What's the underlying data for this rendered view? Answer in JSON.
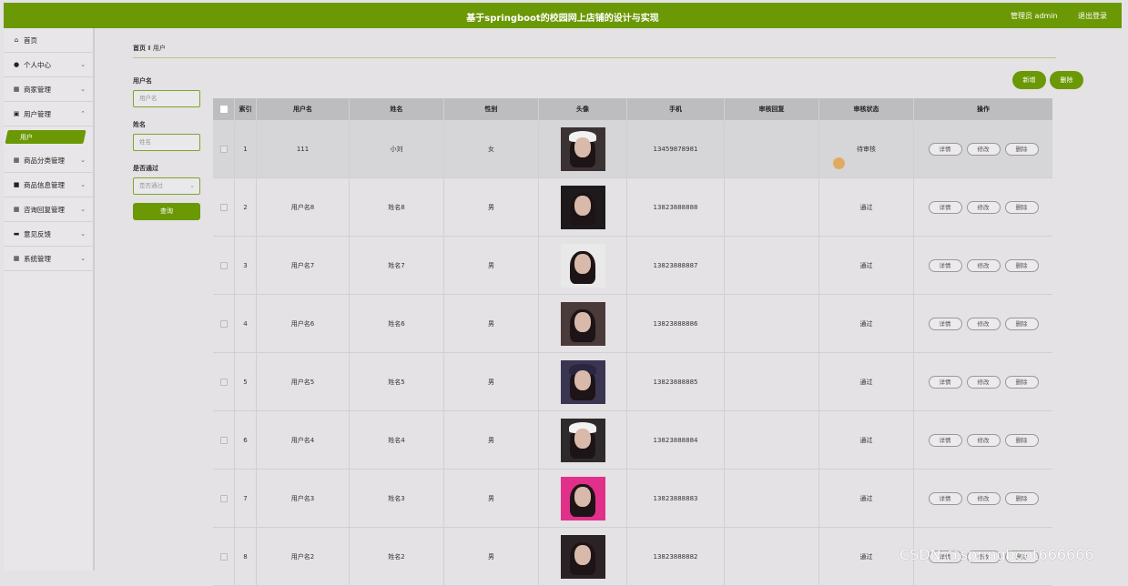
{
  "header": {
    "title": "基于springboot的校园网上店铺的设计与实现",
    "admin_label": "管理员 admin",
    "logout_label": "退出登录"
  },
  "sidebar": {
    "items": [
      {
        "label": "首页",
        "icon": "home-icon"
      },
      {
        "label": "个人中心",
        "icon": "user-icon"
      },
      {
        "label": "商家管理",
        "icon": "grid-icon"
      },
      {
        "label": "用户管理",
        "icon": "users-icon"
      },
      {
        "label": "商品分类管理",
        "icon": "grid-icon"
      },
      {
        "label": "商品信息管理",
        "icon": "box-icon"
      },
      {
        "label": "咨询回复管理",
        "icon": "grid-icon"
      },
      {
        "label": "意见反馈",
        "icon": "feedback-icon"
      },
      {
        "label": "系统管理",
        "icon": "grid-icon"
      }
    ],
    "active_sub": "用户"
  },
  "breadcrumb": {
    "home": "首页",
    "sep": "Ⅱ",
    "current": "用户"
  },
  "search": {
    "username_label": "用户名",
    "username_placeholder": "用户名",
    "name_label": "姓名",
    "name_placeholder": "姓名",
    "approved_label": "是否通过",
    "approved_placeholder": "是否通过",
    "query_button": "查询"
  },
  "actions": {
    "add": "新增",
    "delete": "删除"
  },
  "table": {
    "headers": [
      "索引",
      "用户名",
      "姓名",
      "性别",
      "头像",
      "手机",
      "审核回复",
      "审核状态",
      "操作"
    ],
    "rows": [
      {
        "idx": "1",
        "username": "111",
        "name": "小刘",
        "gender": "女",
        "phone": "13459878981",
        "reply": "",
        "status": "待审核"
      },
      {
        "idx": "2",
        "username": "用户名8",
        "name": "姓名8",
        "gender": "男",
        "phone": "13823888888",
        "reply": "",
        "status": "通过"
      },
      {
        "idx": "3",
        "username": "用户名7",
        "name": "姓名7",
        "gender": "男",
        "phone": "13823888887",
        "reply": "",
        "status": "通过"
      },
      {
        "idx": "4",
        "username": "用户名6",
        "name": "姓名6",
        "gender": "男",
        "phone": "13823888886",
        "reply": "",
        "status": "通过"
      },
      {
        "idx": "5",
        "username": "用户名5",
        "name": "姓名5",
        "gender": "男",
        "phone": "13823888885",
        "reply": "",
        "status": "通过"
      },
      {
        "idx": "6",
        "username": "用户名4",
        "name": "姓名4",
        "gender": "男",
        "phone": "13823888884",
        "reply": "",
        "status": "通过"
      },
      {
        "idx": "7",
        "username": "用户名3",
        "name": "姓名3",
        "gender": "男",
        "phone": "13823888883",
        "reply": "",
        "status": "通过"
      },
      {
        "idx": "8",
        "username": "用户名2",
        "name": "姓名2",
        "gender": "男",
        "phone": "13823888882",
        "reply": "",
        "status": "通过"
      }
    ],
    "op_labels": {
      "detail": "详情",
      "edit": "修改",
      "delete": "删除"
    }
  },
  "watermark": "CSDN @springboot666666",
  "colors": {
    "brand": "#6b9805"
  }
}
